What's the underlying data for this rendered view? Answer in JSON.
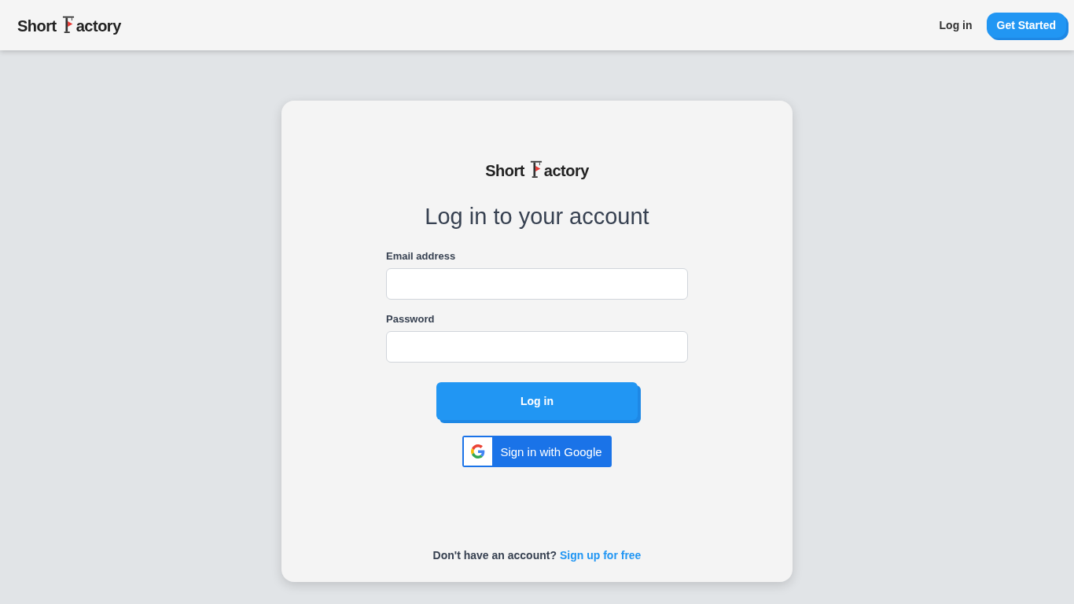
{
  "header": {
    "logo": {
      "first": "Short",
      "second": "actory"
    },
    "login_link": "Log in",
    "cta_button": "Get Started"
  },
  "card": {
    "logo": {
      "first": "Short",
      "second": "actory"
    },
    "title": "Log in to your account",
    "fields": [
      {
        "label": "Email address"
      },
      {
        "label": "Password"
      }
    ],
    "submit_button": "Log in",
    "google_button": "Sign in with Google",
    "footer": {
      "text": "Don't have an account?",
      "link": "Sign up for free"
    }
  }
}
